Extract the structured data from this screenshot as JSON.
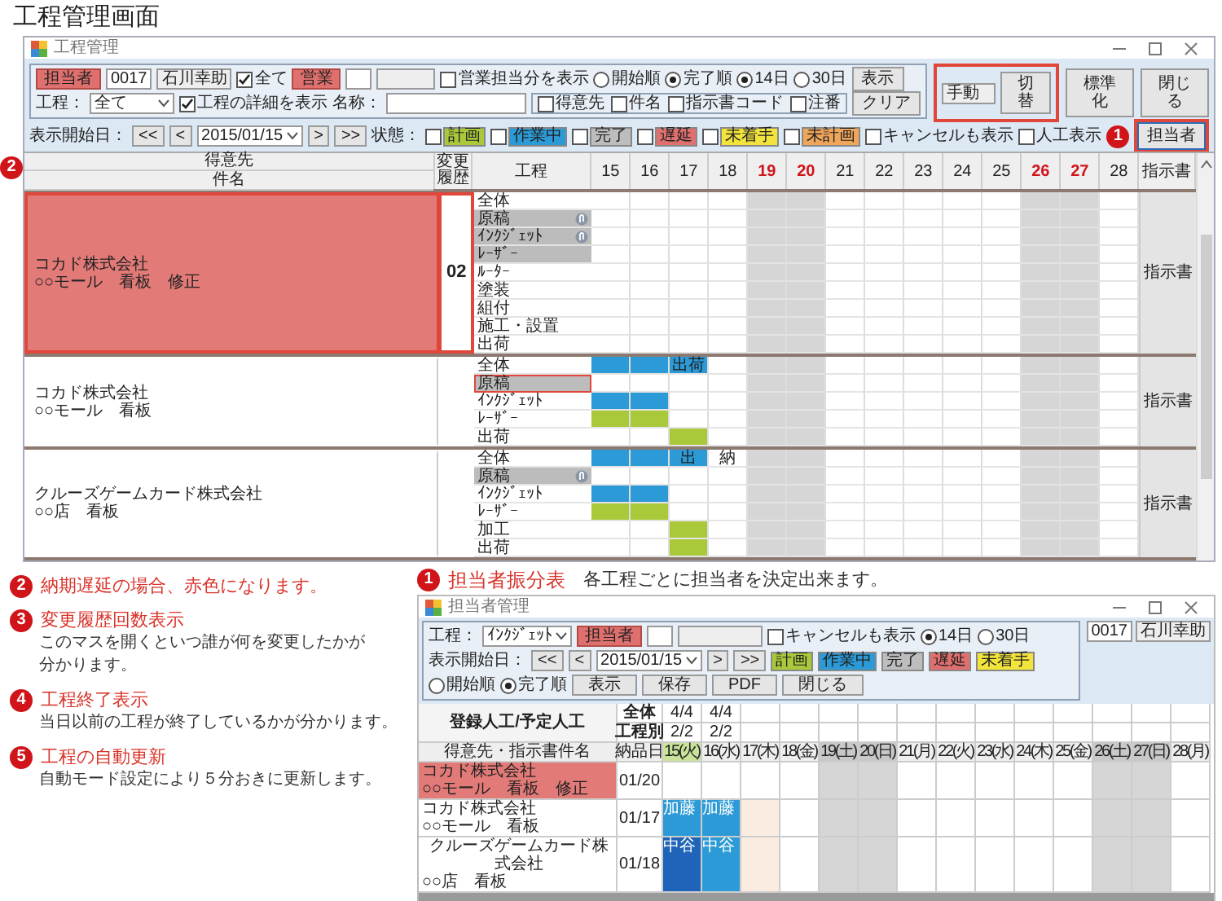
{
  "page_title": "工程管理画面",
  "main_window": {
    "title": "工程管理",
    "toolbar": {
      "staff": {
        "label": "担当者",
        "code": "0017",
        "name": "石川幸助"
      },
      "all_checkbox": {
        "label": "全て",
        "checked": true
      },
      "sales": {
        "label": "営業"
      },
      "sales_only": {
        "label": "営業担当分を表示",
        "checked": false
      },
      "order_radios": [
        {
          "label": "開始順",
          "selected": false
        },
        {
          "label": "完了順",
          "selected": true
        }
      ],
      "span_radios": [
        {
          "label": "14日",
          "selected": true
        },
        {
          "label": "30日",
          "selected": false
        }
      ],
      "show_button": "表示",
      "process": {
        "label": "工程：",
        "value": "全て"
      },
      "detail_checkbox": {
        "label": "工程の詳細を表示",
        "checked": true
      },
      "name": {
        "label": "名称："
      },
      "name_filters": [
        {
          "label": "得意先",
          "checked": false
        },
        {
          "label": "件名",
          "checked": false
        },
        {
          "label": "指示書コード",
          "checked": false
        },
        {
          "label": "注番",
          "checked": false
        }
      ],
      "clear_button": "クリア",
      "start_date": {
        "label": "表示開始日：",
        "prev_buttons": [
          "<<",
          "<"
        ],
        "value": "2015/01/15",
        "next_buttons": [
          ">",
          ">>"
        ]
      },
      "status": {
        "label": "状態：",
        "items": [
          {
            "label": "計画",
            "checked": false,
            "color": "#a9c93b"
          },
          {
            "label": "作業中",
            "checked": false,
            "color": "#2b9ad6"
          },
          {
            "label": "完了",
            "checked": false,
            "color": "#bdbdbd"
          },
          {
            "label": "遅延",
            "checked": false,
            "color": "#e0706e"
          },
          {
            "label": "未着手",
            "checked": false,
            "color": "#f3e43c"
          },
          {
            "label": "未計画",
            "checked": false,
            "color": "#efa55a"
          }
        ]
      },
      "cancel_checkbox": {
        "label": "キャンセルも表示",
        "checked": false
      },
      "manhour_checkbox": {
        "label": "人工表示",
        "checked": false
      }
    },
    "mode": {
      "value": "手動",
      "button": "切替",
      "annotated": true
    },
    "standardize_button": "標準化",
    "close_button": "閉じる",
    "staff_button": {
      "label": "担当者",
      "annotated": true,
      "callout": "1"
    },
    "grid_callout": "2",
    "grid": {
      "columns": {
        "client": "得意先",
        "subject": "件名",
        "history": "変更履歴",
        "process": "工程",
        "instruction": "指示書"
      },
      "dates": [
        {
          "label": "15",
          "holiday": false
        },
        {
          "label": "16",
          "holiday": false
        },
        {
          "label": "17",
          "holiday": false
        },
        {
          "label": "18",
          "holiday": false
        },
        {
          "label": "19",
          "holiday": true
        },
        {
          "label": "20",
          "holiday": true
        },
        {
          "label": "21",
          "holiday": false
        },
        {
          "label": "22",
          "holiday": false
        },
        {
          "label": "23",
          "holiday": false
        },
        {
          "label": "24",
          "holiday": false
        },
        {
          "label": "25",
          "holiday": false
        },
        {
          "label": "26",
          "holiday": true
        },
        {
          "label": "27",
          "holiday": true
        },
        {
          "label": "28",
          "holiday": false
        }
      ],
      "groups": [
        {
          "client": "コカド株式会社",
          "subject": "○○モール　看板　修正",
          "late": true,
          "annotated": true,
          "history": {
            "value": "02",
            "annotated": true
          },
          "instruction": "指示書",
          "processes": [
            {
              "name": "全体",
              "finished": false,
              "attachment": false,
              "annotated": false
            },
            {
              "name": "原稿",
              "finished": true,
              "attachment": true,
              "annotated": false
            },
            {
              "name": "ｲﾝｸｼﾞｪｯﾄ",
              "finished": true,
              "attachment": true,
              "annotated": false
            },
            {
              "name": "ﾚｰｻﾞｰ",
              "finished": true,
              "attachment": false,
              "annotated": false
            },
            {
              "name": "ﾙｰﾀｰ",
              "finished": false,
              "attachment": false,
              "annotated": false
            },
            {
              "name": "塗装",
              "finished": false,
              "attachment": false,
              "annotated": false
            },
            {
              "name": "組付",
              "finished": false,
              "attachment": false,
              "annotated": false
            },
            {
              "name": "施工・設置",
              "finished": false,
              "attachment": false,
              "annotated": false
            },
            {
              "name": "出荷",
              "finished": false,
              "attachment": false,
              "annotated": false
            }
          ]
        },
        {
          "client": "コカド株式会社",
          "subject": "○○モール　看板",
          "late": false,
          "annotated": false,
          "instruction": "指示書",
          "processes": [
            {
              "name": "全体",
              "finished": false,
              "attachment": false,
              "annotated": false,
              "cells": [
                {
                  "color": "#2b9ad6"
                },
                {
                  "color": "#2b9ad6"
                },
                {
                  "color": "#2b9ad6",
                  "text": "出荷"
                }
              ]
            },
            {
              "name": "原稿",
              "finished": true,
              "attachment": false,
              "annotated": true
            },
            {
              "name": "ｲﾝｸｼﾞｪｯﾄ",
              "finished": false,
              "attachment": false,
              "annotated": false,
              "cells": [
                {
                  "color": "#2b9ad6"
                },
                {
                  "color": "#2b9ad6"
                }
              ]
            },
            {
              "name": "ﾚｰｻﾞｰ",
              "finished": false,
              "attachment": false,
              "annotated": false,
              "cells": [
                {
                  "color": "#a9c93b"
                },
                {
                  "color": "#a9c93b"
                }
              ]
            },
            {
              "name": "出荷",
              "finished": false,
              "attachment": false,
              "annotated": false,
              "cells": [
                {},
                {},
                {
                  "color": "#a9c93b"
                }
              ]
            }
          ]
        },
        {
          "client": "クルーズゲームカード株式会社",
          "subject": "○○店　看板",
          "late": false,
          "annotated": false,
          "instruction": "指示書",
          "processes": [
            {
              "name": "全体",
              "finished": false,
              "attachment": false,
              "annotated": false,
              "cells": [
                {
                  "color": "#2b9ad6"
                },
                {
                  "color": "#2b9ad6"
                },
                {
                  "color": "#2b9ad6",
                  "text": "出"
                },
                {
                  "text": "納"
                }
              ]
            },
            {
              "name": "原稿",
              "finished": true,
              "attachment": true,
              "annotated": false
            },
            {
              "name": "ｲﾝｸｼﾞｪｯﾄ",
              "finished": false,
              "attachment": false,
              "annotated": false,
              "cells": [
                {
                  "color": "#2b9ad6"
                },
                {
                  "color": "#2b9ad6"
                }
              ]
            },
            {
              "name": "ﾚｰｻﾞｰ",
              "finished": false,
              "attachment": false,
              "annotated": false,
              "cells": [
                {
                  "color": "#a9c93b"
                },
                {
                  "color": "#a9c93b"
                }
              ]
            },
            {
              "name": "加工",
              "finished": false,
              "attachment": false,
              "annotated": false,
              "cells": [
                {},
                {},
                {
                  "color": "#a9c93b"
                }
              ]
            },
            {
              "name": "出荷",
              "finished": false,
              "attachment": false,
              "annotated": false,
              "cells": [
                {},
                {},
                {
                  "color": "#a9c93b"
                }
              ]
            }
          ]
        }
      ]
    }
  },
  "notes": [
    {
      "number": "2",
      "title": "納期遅延の場合、赤色になります。"
    },
    {
      "number": "3",
      "title": "変更履歴回数表示",
      "lines": [
        "このマスを開くといつ誰が何を変更したかが",
        "分かります。"
      ]
    },
    {
      "number": "4",
      "title": "工程終了表示",
      "lines": [
        "当日以前の工程が終了しているかが分かります。"
      ]
    },
    {
      "number": "5",
      "title": "工程の自動更新",
      "lines": [
        "自動モード設定により５分おきに更新します。"
      ]
    }
  ],
  "feature": {
    "number": "1",
    "title": "担当者振分表",
    "text": "各工程ごとに担当者を決定出来ます。"
  },
  "inset_window": {
    "title": "担当者管理",
    "toolbar": {
      "process": {
        "label": "工程：",
        "value": "ｲﾝｸｼﾞｪｯﾄ"
      },
      "staff": {
        "label": "担当者"
      },
      "cancel_checkbox": {
        "label": "キャンセルも表示",
        "checked": false
      },
      "span_radios": [
        {
          "label": "14日",
          "selected": true
        },
        {
          "label": "30日",
          "selected": false
        }
      ],
      "start_date": {
        "label": "表示開始日：",
        "prev_buttons": [
          "<<",
          "<"
        ],
        "value": "2015/01/15",
        "next_buttons": [
          ">",
          ">>"
        ]
      },
      "legend": [
        {
          "label": "計画",
          "color": "#a9c93b"
        },
        {
          "label": "作業中",
          "color": "#2b9ad6"
        },
        {
          "label": "完了",
          "color": "#bdbdbd"
        },
        {
          "label": "遅延",
          "color": "#e0706e"
        },
        {
          "label": "未着手",
          "color": "#f3e43c"
        }
      ],
      "order_radios": [
        {
          "label": "開始順",
          "selected": false
        },
        {
          "label": "完了順",
          "selected": true
        }
      ],
      "buttons": [
        "表示",
        "保存",
        "PDF",
        "閉じる"
      ],
      "user": {
        "code": "0017",
        "name": "石川幸助"
      }
    },
    "summary": {
      "title": "登録人工/予定人工",
      "rows": [
        {
          "label": "全体",
          "values": [
            "4/4",
            "4/4"
          ]
        },
        {
          "label": "工程別",
          "values": [
            "2/2",
            "2/2"
          ]
        }
      ]
    },
    "table": {
      "columns": {
        "subject": "得意先・指示書件名",
        "due": "納品日"
      },
      "days": [
        {
          "label": "15(火)",
          "holiday": false,
          "today": true
        },
        {
          "label": "16(水)",
          "holiday": false,
          "today": false
        },
        {
          "label": "17(木)",
          "holiday": false,
          "today": false
        },
        {
          "label": "18(金)",
          "holiday": false,
          "today": false
        },
        {
          "label": "19(土)",
          "holiday": true,
          "today": false
        },
        {
          "label": "20(日)",
          "holiday": true,
          "today": false
        },
        {
          "label": "21(月)",
          "holiday": false,
          "today": false
        },
        {
          "label": "22(火)",
          "holiday": false,
          "today": false
        },
        {
          "label": "23(水)",
          "holiday": false,
          "today": false
        },
        {
          "label": "24(木)",
          "holiday": false,
          "today": false
        },
        {
          "label": "25(金)",
          "holiday": false,
          "today": false
        },
        {
          "label": "26(土)",
          "holiday": true,
          "today": false
        },
        {
          "label": "27(日)",
          "holiday": true,
          "today": false
        },
        {
          "label": "28(月)",
          "holiday": false,
          "today": false
        }
      ],
      "rows": [
        {
          "client": "コカド株式会社",
          "subject": "○○モール　看板　修正",
          "late": true,
          "due": "01/20"
        },
        {
          "client": "コカド株式会社",
          "subject": "○○モール　看板",
          "late": false,
          "due": "01/17",
          "cells": [
            {
              "color": "#2b9ad6",
              "text": "加藤"
            },
            {
              "color": "#2b9ad6",
              "text": "加藤"
            },
            {
              "color": "#fbece2"
            }
          ]
        },
        {
          "client": "クルーズゲームカード株式会社",
          "subject": "○○店　看板",
          "late": false,
          "due": "01/18",
          "cells": [
            {
              "color": "#1f64b8",
              "text": "中谷"
            },
            {
              "color": "#2b9ad6",
              "text": "中谷"
            },
            {
              "color": "#fbece2"
            }
          ]
        }
      ]
    }
  }
}
